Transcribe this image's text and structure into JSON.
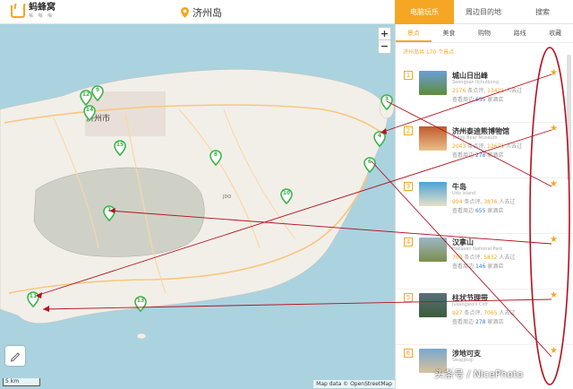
{
  "header": {
    "logo_text": "蚂蜂窝",
    "logo_sub": "嗡 嗡 嗡",
    "location": "济州岛",
    "tabs": [
      {
        "label": "电脑玩乐"
      },
      {
        "label": "周边目的地"
      },
      {
        "label": "搜索"
      }
    ]
  },
  "map": {
    "zoom_in": "+",
    "zoom_out": "−",
    "scale_label": "5 km",
    "attribution": "Map data © OpenStreetMap",
    "city_label": "济州市",
    "markers": [
      "3",
      "4",
      "6",
      "7",
      "8",
      "9",
      "10",
      "11",
      "12",
      "13",
      "14",
      "15",
      "1",
      "2",
      "5"
    ]
  },
  "panel": {
    "categories": [
      {
        "label": "景点"
      },
      {
        "label": "美食"
      },
      {
        "label": "购物"
      },
      {
        "label": "路线"
      },
      {
        "label": "收藏"
      }
    ],
    "count_text": "济州岛共 170 个景点",
    "items": [
      {
        "rank": "1",
        "name": "城山日出峰",
        "en": "Seongsan Ilchulbong",
        "score": "2176",
        "score_unit": "条点评",
        "visitors": "13421",
        "visitors_unit": "人去过",
        "nearby_pre": "查看周边",
        "hotels": "655",
        "hotels_unit": "家酒店"
      },
      {
        "rank": "2",
        "name": "济州泰迪熊博物馆",
        "en": "Teddy Bear Museum",
        "score": "2043",
        "score_unit": "条点评",
        "visitors": "12671",
        "visitors_unit": "人去过",
        "nearby_pre": "查看周边",
        "hotels": "278",
        "hotels_unit": "家酒店"
      },
      {
        "rank": "3",
        "name": "牛岛",
        "en": "Udo Island",
        "score": "994",
        "score_unit": "条点评",
        "visitors": "3876",
        "visitors_unit": "人去过",
        "nearby_pre": "查看周边",
        "hotels": "655",
        "hotels_unit": "家酒店"
      },
      {
        "rank": "4",
        "name": "汉拿山",
        "en": "Hallasan National Park",
        "score": "703",
        "score_unit": "条点评",
        "visitors": "5832",
        "visitors_unit": "人去过",
        "nearby_pre": "查看周边",
        "hotels": "146",
        "hotels_unit": "家酒店"
      },
      {
        "rank": "5",
        "name": "柱状节理带",
        "en": "Jusangjeolli Cliff",
        "score": "927",
        "score_unit": "条点评",
        "visitors": "7065",
        "visitors_unit": "人去过",
        "nearby_pre": "查看周边",
        "hotels": "278",
        "hotels_unit": "家酒店"
      },
      {
        "rank": "6",
        "name": "涉地可支",
        "en": "Seopjikoji",
        "score": "",
        "score_unit": "",
        "visitors": "",
        "visitors_unit": "",
        "nearby_pre": "",
        "hotels": "",
        "hotels_unit": ""
      }
    ]
  },
  "watermark": "头条号 / NicePhoto",
  "colors": {
    "accent": "#f5a623",
    "marker": "#3cb44b",
    "annotation": "#b5101e"
  }
}
